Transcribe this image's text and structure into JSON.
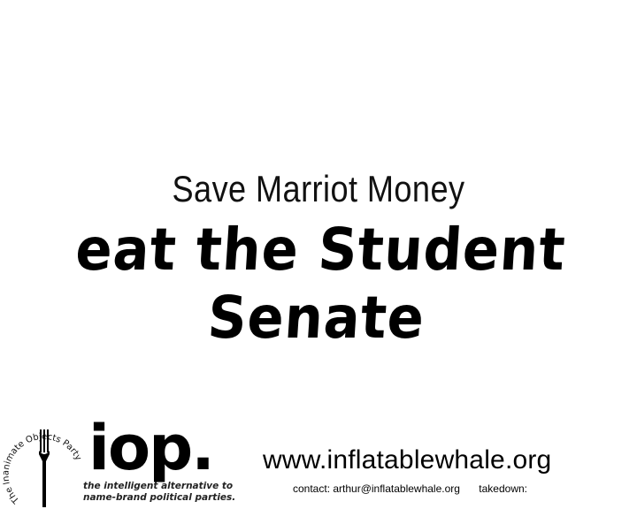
{
  "poster": {
    "subtitle": "Save Marriot Money",
    "headline": "eat the Student Senate"
  },
  "logo": {
    "ring_text": "The Inanimate Objects Party",
    "wordmark": "iop.",
    "tagline_line1": "the intelligent alternative to",
    "tagline_line2": "name-brand political parties.",
    "icon": "fork-icon"
  },
  "footer": {
    "url": "www.inflatablewhale.org",
    "contact": "contact: arthur@inflatablewhale.org",
    "takedown": "takedown:"
  }
}
